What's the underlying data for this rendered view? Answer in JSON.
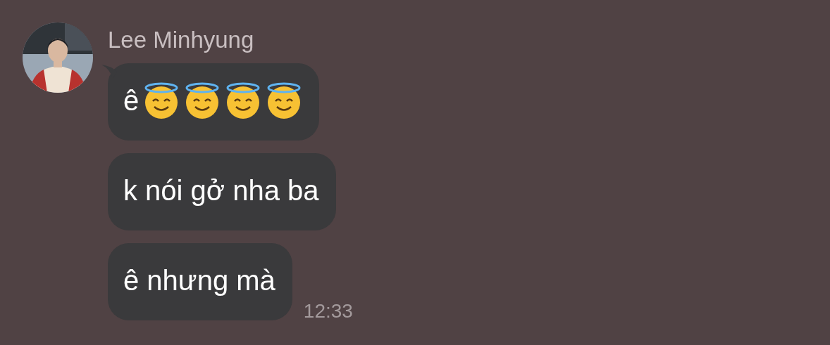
{
  "sender": {
    "name": "Lee Minhyung"
  },
  "messages": [
    {
      "text": "ê",
      "emojis": [
        {
          "kind": "halo-smile"
        },
        {
          "kind": "halo-smile"
        },
        {
          "kind": "halo-smile"
        },
        {
          "kind": "halo-smile"
        }
      ]
    },
    {
      "text": "k nói gở nha ba"
    },
    {
      "text": "ê nhưng mà",
      "time": "12:33"
    }
  ]
}
